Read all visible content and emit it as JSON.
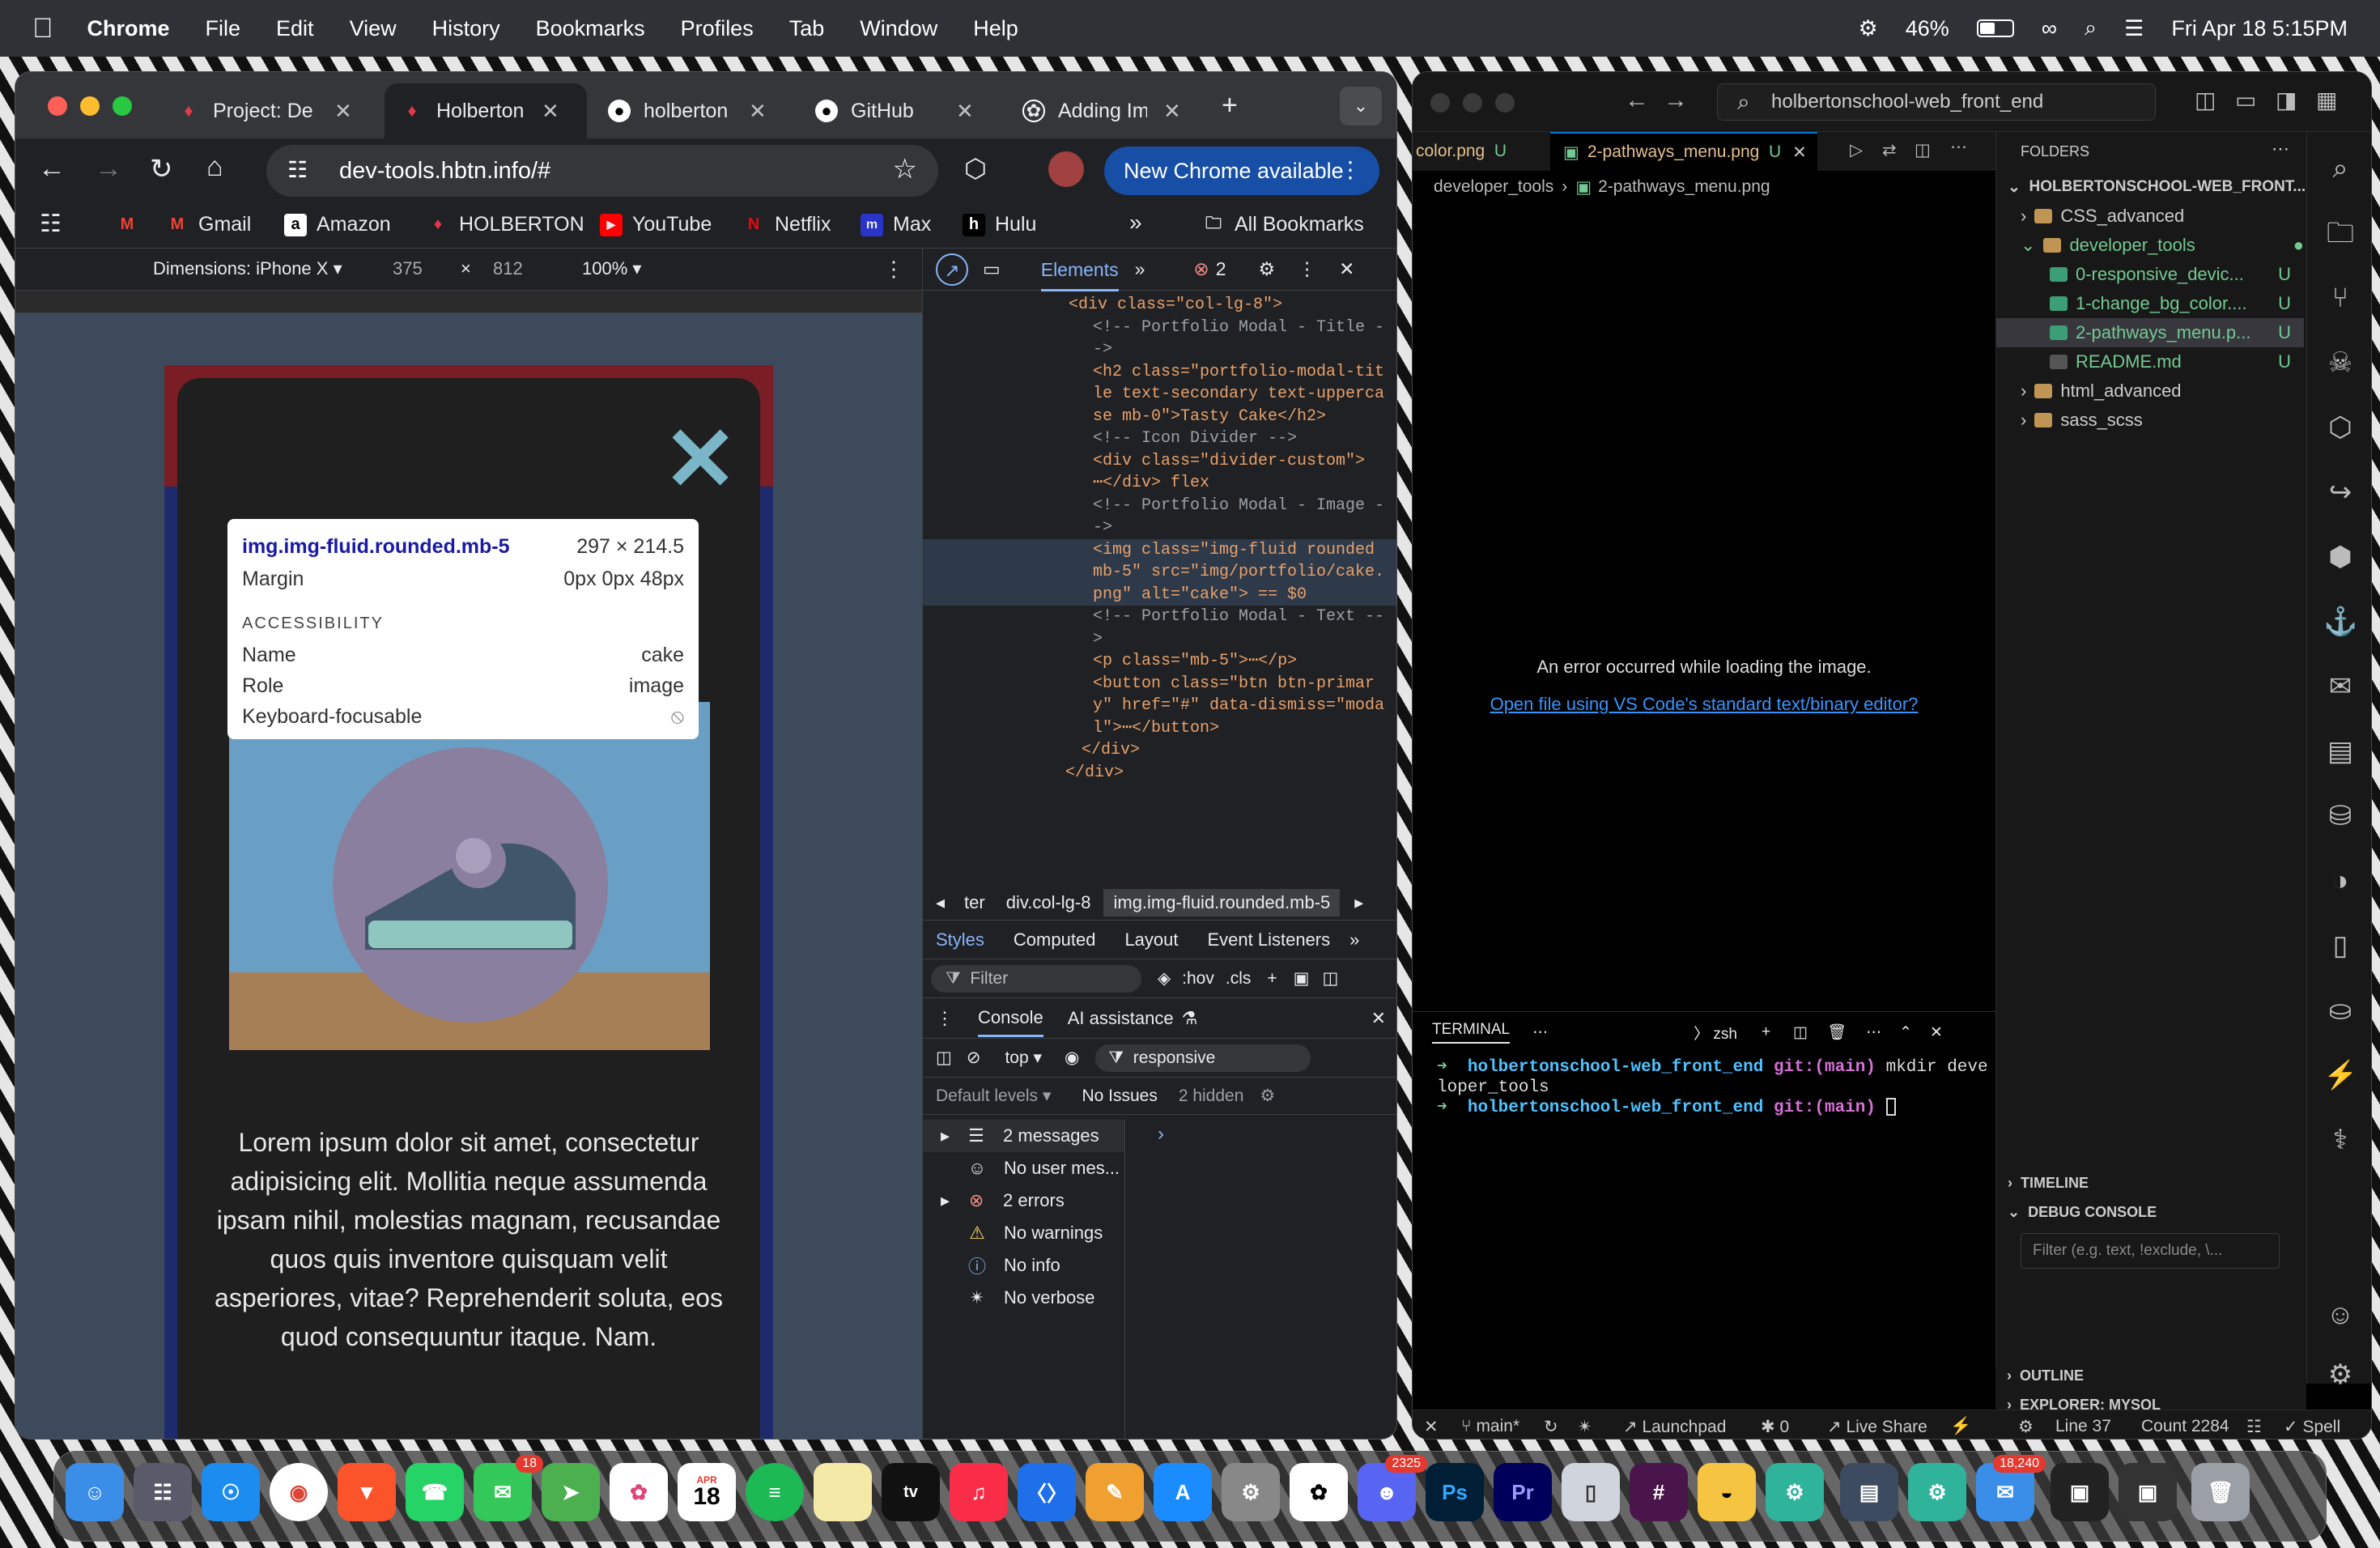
{
  "menubar": {
    "app": "Chrome",
    "items": [
      "File",
      "Edit",
      "View",
      "History",
      "Bookmarks",
      "Profiles",
      "Tab",
      "Window",
      "Help"
    ],
    "battery": "46%",
    "datetime": "Fri Apr 18  5:15PM"
  },
  "chrome": {
    "tabs": [
      {
        "label": "Project: De",
        "favicon": "holberton-icon"
      },
      {
        "label": "Holberton",
        "favicon": "holberton-icon"
      },
      {
        "label": "holberton",
        "favicon": "github-icon"
      },
      {
        "label": "GitHub",
        "favicon": "github-icon"
      },
      {
        "label": "Adding Im",
        "favicon": "chatgpt-icon"
      }
    ],
    "url": "dev-tools.hbtn.info/#",
    "update_button": "New Chrome available",
    "bookmarks": [
      {
        "label": "",
        "icon": "gmail-icon"
      },
      {
        "label": "Gmail",
        "icon": "gmail-icon"
      },
      {
        "label": "Amazon",
        "icon": "amazon-icon"
      },
      {
        "label": "HOLBERTON",
        "icon": "holberton-icon"
      },
      {
        "label": "YouTube",
        "icon": "youtube-icon"
      },
      {
        "label": "Netflix",
        "icon": "netflix-icon"
      },
      {
        "label": "Max",
        "icon": "max-icon"
      },
      {
        "label": "Hulu",
        "icon": "hulu-icon"
      }
    ],
    "all_bookmarks": "All Bookmarks",
    "device": {
      "dimensions_label": "Dimensions: iPhone X",
      "width": "375",
      "times": "×",
      "height": "812",
      "zoom": "100%"
    }
  },
  "page": {
    "tooltip": {
      "selector": "img.img-fluid.rounded.mb-5",
      "size": "297 × 214.5",
      "margin_label": "Margin",
      "margin_value": "0px 0px 48px",
      "accessibility_heading": "ACCESSIBILITY",
      "name_label": "Name",
      "name_value": "cake",
      "role_label": "Role",
      "role_value": "image",
      "keyboard_label": "Keyboard-focusable"
    },
    "lorem": "Lorem ipsum dolor sit amet, consectetur adipisicing elit. Mollitia neque assumenda ipsam nihil, molestias magnam, recusandae quos quis inventore quisquam velit asperiores, vitae? Reprehenderit soluta, eos quod consequuntur itaque. Nam."
  },
  "devtools": {
    "elements_tab": "Elements",
    "error_count": "2",
    "code_lines": [
      "<div class=\"col-lg-8\">",
      "<!-- Portfolio Modal - Title -",
      "->",
      "<h2 class=\"portfolio-modal-tit",
      "le text-secondary text-upperca",
      "se mb-0\">Tasty Cake</h2>",
      "<!-- Icon Divider -->",
      "<div class=\"divider-custom\">",
      "⋯</div> flex",
      "<!-- Portfolio Modal - Image -",
      "->",
      "<img class=\"img-fluid rounded",
      "mb-5\" src=\"img/portfolio/cake.",
      "png\" alt=\"cake\"> == $0",
      "<!-- Portfolio Modal - Text --",
      ">",
      "<p class=\"mb-5\">⋯</p>",
      "<button class=\"btn btn-primar",
      "y\" href=\"#\" data-dismiss=\"moda",
      "l\">⋯</button>",
      "</div>",
      "</div>"
    ],
    "crumbs": [
      "ter",
      "div.col-lg-8",
      "img.img-fluid.rounded.mb-5"
    ],
    "subtabs": [
      "Styles",
      "Computed",
      "Layout",
      "Event Listeners"
    ],
    "filter_placeholder": "Filter",
    "hov": ":hov",
    "cls": ".cls",
    "console_tab": "Console",
    "ai_tab": "AI assistance",
    "context": "top",
    "console_filter": "responsive",
    "default_levels": "Default levels",
    "no_issues": "No Issues",
    "hidden": "2 hidden",
    "console_items": [
      {
        "label": "2 messages",
        "icon": "list-icon"
      },
      {
        "label": "No user mes...",
        "icon": "user-icon"
      },
      {
        "label": "2 errors",
        "icon": "error-icon"
      },
      {
        "label": "No warnings",
        "icon": "warning-icon"
      },
      {
        "label": "No info",
        "icon": "info-icon"
      },
      {
        "label": "No verbose",
        "icon": "bug-icon"
      }
    ]
  },
  "vscode": {
    "search": "holbertonschool-web_front_end",
    "tabs": [
      {
        "label": "color.png",
        "status": "U"
      },
      {
        "label": "2-pathways_menu.png",
        "status": "U"
      }
    ],
    "breadcrumb": [
      "developer_tools",
      "2-pathways_menu.png"
    ],
    "error_message": "An error occurred while loading the image.",
    "error_link": "Open file using VS Code's standard text/binary editor?",
    "terminal": {
      "label": "TERMINAL",
      "shell": "zsh",
      "lines": [
        {
          "prompt": "holbertonschool-web_front_end",
          "branch": "git:(main)",
          "cmd": "mkdir deve"
        },
        {
          "prompt": "",
          "branch": "",
          "cmd": "loper_tools"
        },
        {
          "prompt": "holbertonschool-web_front_end",
          "branch": "git:(main)",
          "cmd": ""
        }
      ]
    },
    "explorer": {
      "heading": "FOLDERS",
      "root": "HOLBERTONSCHOOL-WEB_FRONT...",
      "items": [
        {
          "label": "CSS_advanced",
          "kind": "folder",
          "status": ""
        },
        {
          "label": "developer_tools",
          "kind": "folder-open",
          "status": ""
        },
        {
          "label": "0-responsive_devic...",
          "kind": "image",
          "status": "U"
        },
        {
          "label": "1-change_bg_color....",
          "kind": "image",
          "status": "U"
        },
        {
          "label": "2-pathways_menu.p...",
          "kind": "image",
          "status": "U"
        },
        {
          "label": "README.md",
          "kind": "markdown",
          "status": "U"
        },
        {
          "label": "html_advanced",
          "kind": "folder",
          "status": ""
        },
        {
          "label": "sass_scss",
          "kind": "folder",
          "status": ""
        }
      ],
      "timeline": "TIMELINE",
      "debug_console": "DEBUG CONSOLE",
      "debug_filter": "Filter (e.g. text, !exclude, \\...",
      "outline": "OUTLINE",
      "explorer_mysql": "EXPLORER: MYSQL"
    },
    "status": {
      "branch": "main*",
      "launchpad": "Launchpad",
      "ports": "0",
      "live_share": "Live Share",
      "line": "Line 37",
      "count": "Count 2284",
      "spell": "Spell"
    }
  },
  "dock": {
    "badges": {
      "messages": "18",
      "discord": "2325",
      "mail": "18,240"
    },
    "calendar_month": "APR",
    "calendar_day": "18"
  },
  "colors": {
    "accent_blue": "#1a73e8",
    "chrome_update": "#174ea6",
    "vscode_untracked": "#73c991",
    "modal_bg": "#1f1f1f"
  }
}
